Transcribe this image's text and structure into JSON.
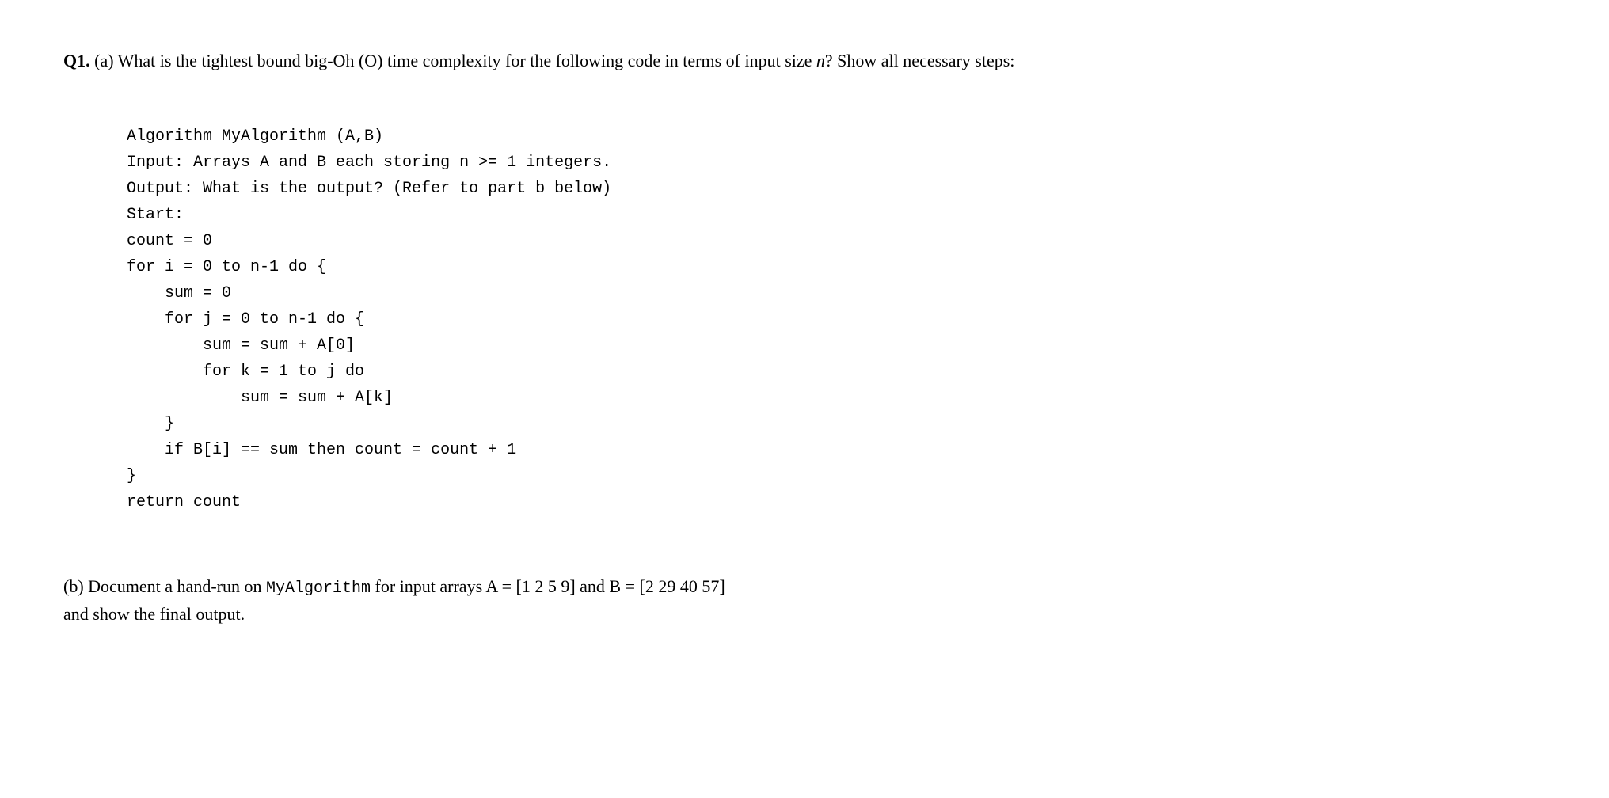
{
  "question1": {
    "label": "Q1.",
    "part_a_text": "(a) What is the tightest bound big-Oh (O) time complexity for the following code in terms of input size ",
    "part_a_n": "n",
    "part_a_text2": "? Show all necessary steps:",
    "code": {
      "line1": "Algorithm MyAlgorithm (A,B)",
      "line2": "Input: Arrays A and B each storing n >= 1 integers.",
      "line3": "Output: What is the output? (Refer to part b below)",
      "line4": "Start:",
      "line5": "count = 0",
      "line6": "for i = 0 to n-1 do {",
      "line7": "    sum = 0",
      "line8": "    for j = 0 to n-1 do {",
      "line9": "        sum = sum + A[0]",
      "line10": "        for k = 1 to j do",
      "line11": "            sum = sum + A[k]",
      "line12": "    }",
      "line13": "    if B[i] == sum then count = count + 1",
      "line14": "}",
      "line15": "return count"
    },
    "part_b_text1": "(b) Document a hand-run on ",
    "part_b_inline_code": "MyAlgorithm",
    "part_b_text2": " for input arrays A = [1  2  5  9] and B = [2  29  40  57]",
    "part_b_text3": "and show the final output."
  }
}
